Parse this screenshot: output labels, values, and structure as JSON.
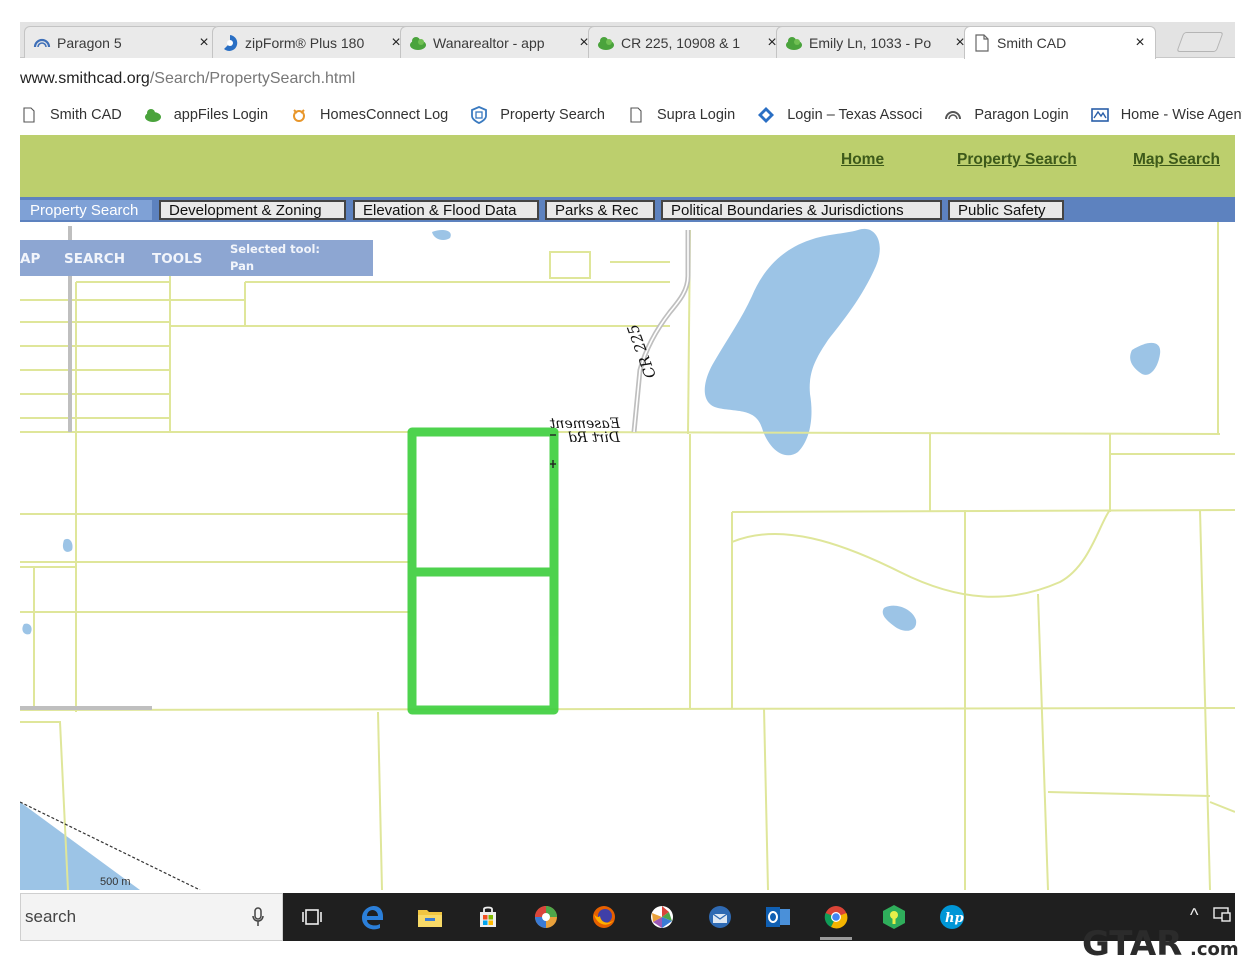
{
  "browser": {
    "tabs": [
      {
        "title": "Paragon 5",
        "icon": "paragon-icon"
      },
      {
        "title": "zipForm® Plus 180",
        "icon": "zipform-icon"
      },
      {
        "title": "Wanarealtor - app",
        "icon": "cloud-icon"
      },
      {
        "title": "CR 225, 10908 & 1",
        "icon": "cloud-icon"
      },
      {
        "title": "Emily Ln, 1033 - Po",
        "icon": "cloud-icon"
      },
      {
        "title": "Smith CAD",
        "icon": "page-icon",
        "active": true
      }
    ],
    "tab_close_glyph": "×",
    "address": {
      "host": "www.smithcad.org",
      "path": "/Search/PropertySearch.html"
    },
    "bookmarks": [
      {
        "label": "Smith CAD",
        "icon": "page-icon"
      },
      {
        "label": "appFiles Login",
        "icon": "cloud-icon"
      },
      {
        "label": "HomesConnect Log",
        "icon": "homesconnect-icon"
      },
      {
        "label": "Property Search",
        "icon": "shield-icon"
      },
      {
        "label": "Supra Login",
        "icon": "page-icon"
      },
      {
        "label": "Login – Texas Associ",
        "icon": "diamond-icon"
      },
      {
        "label": "Paragon Login",
        "icon": "paragon-icon"
      },
      {
        "label": "Home - Wise Agent",
        "icon": "wise-agent-icon"
      }
    ]
  },
  "site": {
    "header_links": [
      "Home",
      "Property Search",
      "Map Search"
    ],
    "nav_tabs": [
      {
        "label": "Property Search",
        "active": true
      },
      {
        "label": "Development & Zoning"
      },
      {
        "label": "Elevation & Flood Data"
      },
      {
        "label": "Parks & Rec"
      },
      {
        "label": "Political Boundaries & Jurisdictions"
      },
      {
        "label": "Public Safety"
      }
    ],
    "colors": {
      "header": "#bccf6d",
      "nav": "#5d82bf",
      "parcel_lines": "#dfe69a",
      "water": "#9cc4e6",
      "highlight": "#3fcf3f"
    }
  },
  "map": {
    "toolbar": {
      "map": "AP",
      "search": "SEARCH",
      "tools": "TOOLS",
      "selected_tool_label": "Selected tool:",
      "selected_tool": "Pan"
    },
    "annotations": {
      "road": "CR 225",
      "easement_line1": "Dirt Rd",
      "easement_line2": "Easement"
    },
    "scale": "500 m"
  },
  "taskbar": {
    "search_placeholder": "search",
    "icons": [
      "task-view-icon",
      "edge-icon",
      "file-explorer-icon",
      "store-icon",
      "photos-icon",
      "firefox-icon",
      "picasa-icon",
      "thunderbird-icon",
      "outlook-icon",
      "chrome-icon",
      "keeper-icon",
      "hp-icon"
    ]
  },
  "watermark": "GTAR.com"
}
